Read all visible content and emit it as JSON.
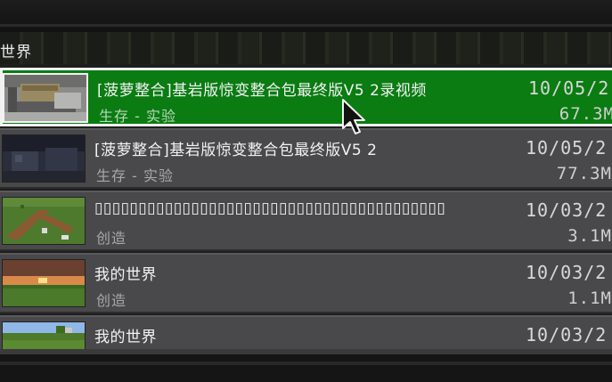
{
  "section": {
    "title": "世界"
  },
  "worlds": [
    {
      "name": "[菠萝整合]基岩版惊变整合包最终版V5 2录视频",
      "mode": "生存 - 实验",
      "date": "10/05/2",
      "size": "67.3M",
      "selected": true,
      "thumb": "kitchen-icon"
    },
    {
      "name": "[菠萝整合]基岩版惊变整合包最终版V5 2",
      "mode": "生存 - 实验",
      "date": "10/05/2",
      "size": "77.3M",
      "selected": false,
      "thumb": "dark-room-icon"
    },
    {
      "name": "▯▯▯▯▯▯▯▯▯▯▯▯▯▯▯▯▯▯▯▯▯▯▯▯▯▯▯▯▯▯▯▯▯▯▯▯▯▯▯▯",
      "mode": "创造",
      "date": "10/03/2",
      "size": "3.1M",
      "selected": false,
      "thumb": "grass-path-icon"
    },
    {
      "name": "我的世界",
      "mode": "创造",
      "date": "10/03/2",
      "size": "1.1M",
      "selected": false,
      "thumb": "sunset-icon"
    },
    {
      "name": "我的世界",
      "mode": "",
      "date": "10/03/2",
      "size": "",
      "selected": false,
      "thumb": "grass-field-icon"
    }
  ],
  "colors": {
    "selected_bg": "#0a7c12",
    "row_bg": "#49494b",
    "selected_border": "#f2f2f2"
  },
  "cursor": "mouse-pointer-icon"
}
